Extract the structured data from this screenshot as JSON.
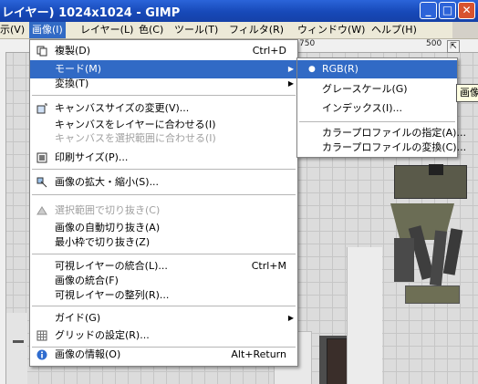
{
  "window": {
    "title": "レイヤー) 1024x1024 - GIMP",
    "min_glyph": "_",
    "max_glyph": "□",
    "close_glyph": "✕"
  },
  "menubar": {
    "items": [
      "示(V)",
      "画像(I)",
      "レイヤー(L)",
      "色(C)",
      "ツール(T)",
      "フィルタ(R)",
      "ウィンドウ(W)",
      "ヘルプ(H)"
    ]
  },
  "ruler": {
    "labels": [
      "750",
      "500"
    ]
  },
  "image_menu": {
    "items": [
      {
        "label": "複製(D)",
        "shortcut": "Ctrl+D"
      },
      {
        "label": "モード(M)"
      },
      {
        "label": "変換(T)"
      },
      {
        "label": "キャンバスサイズの変更(V)..."
      },
      {
        "label": "キャンバスをレイヤーに合わせる(I)"
      },
      {
        "label": "キャンバスを選択範囲に合わせる(I)"
      },
      {
        "label": "印刷サイズ(P)..."
      },
      {
        "label": "画像の拡大・縮小(S)..."
      },
      {
        "label": "選択範囲で切り抜き(C)"
      },
      {
        "label": "画像の自動切り抜き(A)"
      },
      {
        "label": "最小枠で切り抜き(Z)"
      },
      {
        "label": "可視レイヤーの統合(L)...",
        "shortcut": "Ctrl+M"
      },
      {
        "label": "画像の統合(F)"
      },
      {
        "label": "可視レイヤーの整列(R)..."
      },
      {
        "label": "ガイド(G)"
      },
      {
        "label": "グリッドの設定(R)..."
      },
      {
        "label": "画像の情報(O)",
        "shortcut": "Alt+Return"
      }
    ]
  },
  "mode_menu": {
    "items": [
      {
        "label": "RGB(R)",
        "selected": true
      },
      {
        "label": "グレースケール(G)"
      },
      {
        "label": "インデックス(I)..."
      },
      {
        "label": "カラープロファイルの指定(A)..."
      },
      {
        "label": "カラープロファイルの変換(C)..."
      }
    ]
  },
  "tooltip": {
    "text": "画像"
  }
}
